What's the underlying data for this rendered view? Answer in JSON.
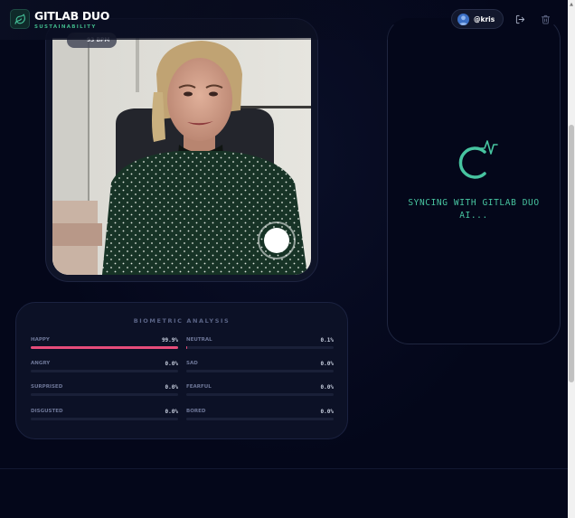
{
  "header": {
    "brand_title": "GITLAB DUO",
    "brand_subtitle": "SUSTAINABILITY",
    "logo_icon": "leaf-icon",
    "user": {
      "name": "@kris",
      "avatar_icon": "user-avatar-icon"
    },
    "logout_icon": "logout-icon",
    "delete_icon": "trash-icon"
  },
  "camera": {
    "bpm_label": "93 BPM",
    "shutter_icon": "shutter-button-icon"
  },
  "sync": {
    "icon": "sync-pulse-icon",
    "text_line1": "SYNCING WITH GITLAB DUO",
    "text_line2": "AI..."
  },
  "biometric": {
    "title": "BIOMETRIC ANALYSIS",
    "emotions": [
      {
        "label": "HAPPY",
        "value": "99.9%",
        "fraction": 0.999
      },
      {
        "label": "NEUTRAL",
        "value": "0.1%",
        "fraction": 0.001
      },
      {
        "label": "ANGRY",
        "value": "0.0%",
        "fraction": 0.0
      },
      {
        "label": "SAD",
        "value": "0.0%",
        "fraction": 0.0
      },
      {
        "label": "SURPRISED",
        "value": "0.0%",
        "fraction": 0.0
      },
      {
        "label": "FEARFUL",
        "value": "0.0%",
        "fraction": 0.0
      },
      {
        "label": "DISGUSTED",
        "value": "0.0%",
        "fraction": 0.0
      },
      {
        "label": "BORED",
        "value": "0.0%",
        "fraction": 0.0
      }
    ]
  },
  "colors": {
    "accent_teal": "#47c4a0",
    "accent_pink": "#e64c7a",
    "background": "#04071a"
  }
}
